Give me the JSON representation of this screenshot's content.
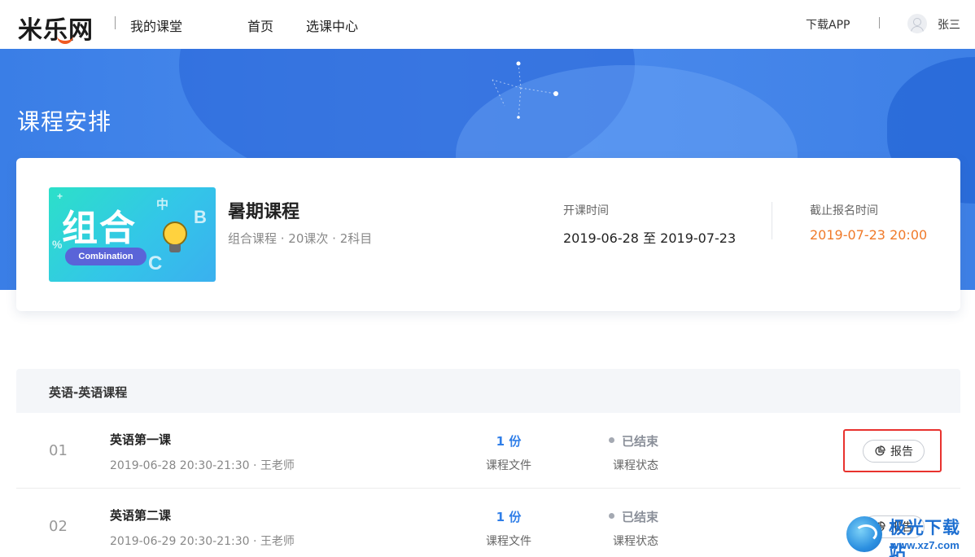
{
  "header": {
    "logo": "米乐网",
    "subtitle": "我的课堂",
    "nav": [
      "首页",
      "选课中心"
    ],
    "download": "下载APP",
    "username": "张三",
    "logo_accent": "#f05a22"
  },
  "banner": {
    "title": "课程安排",
    "color": "#3a7ee6"
  },
  "course": {
    "thumb_big": "组合",
    "thumb_pill": "Combination",
    "thumb_chars": [
      "中",
      "B",
      "C",
      "%",
      "+"
    ],
    "name": "暑期课程",
    "meta": "组合课程 · 20课次 · 2科目",
    "start_label": "开课时间",
    "start_value": "2019-06-28 至 2019-07-23",
    "end_label": "截止报名时间",
    "end_value": "2019-07-23 20:00",
    "end_color": "#f07a2a"
  },
  "section": {
    "title": "英语-英语课程"
  },
  "lessons": [
    {
      "num": "01",
      "name": "英语第一课",
      "time": "2019-06-28 20:30-21:30 · 王老师",
      "files_value": "1 份",
      "files_label": "课程文件",
      "status": "已结束",
      "status_label": "课程状态",
      "report": "报告"
    },
    {
      "num": "02",
      "name": "英语第二课",
      "time": "2019-06-29 20:30-21:30 · 王老师",
      "files_value": "1 份",
      "files_label": "课程文件",
      "status": "已结束",
      "status_label": "课程状态",
      "report": "报告"
    }
  ],
  "watermark": {
    "text": "极光下载站",
    "url": "www.xz7.com"
  },
  "colors": {
    "link_blue": "#2f7ee8",
    "highlight_red": "#e8322e"
  }
}
